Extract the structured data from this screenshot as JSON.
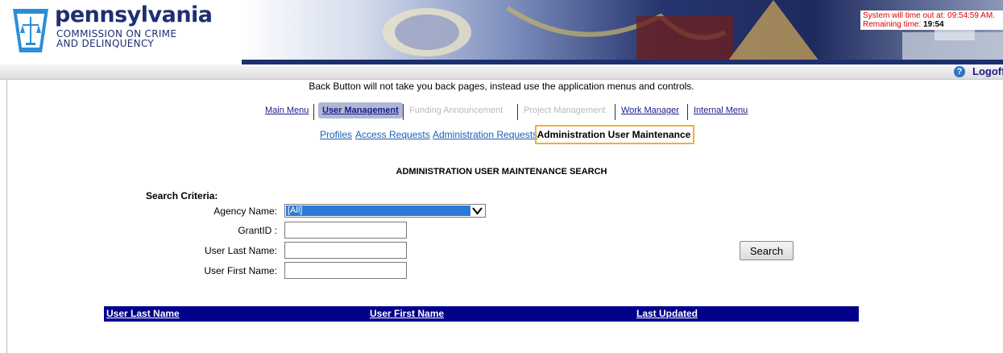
{
  "header": {
    "logo_title": "pennsylvania",
    "logo_sub_line1": "COMMISSION ON CRIME",
    "logo_sub_line2": "AND DELINQUENCY",
    "timeout_text": "System will time out at: 09:54:59 AM.",
    "remaining_label": "Remaining time: ",
    "remaining_value": "19:54"
  },
  "toolbar": {
    "help_icon": "help-icon",
    "logoff_label": "Logoff"
  },
  "notice": "Back Button will not take you back pages, instead use the application menus and controls.",
  "menu": {
    "main_menu": "Main Menu",
    "user_management": "User Management",
    "funding_announcement": "Funding Announcement",
    "project_management": "Project Management",
    "work_manager": "Work Manager",
    "internal_menu": "Internal Menu"
  },
  "submenu": {
    "profiles": "Profiles",
    "access_requests": "Access Requests",
    "administration_requests": "Administration Requests",
    "administration_user_maintenance": "Administration User Maintenance"
  },
  "search": {
    "title": "ADMINISTRATION USER MAINTENANCE SEARCH",
    "criteria_label": "Search Criteria:",
    "agency_label": "Agency Name:",
    "agency_value": "[All]",
    "grantid_label": "GrantID :",
    "last_name_label": "User Last Name:",
    "first_name_label": "User First Name:",
    "grantid_value": "",
    "last_name_value": "",
    "first_name_value": "",
    "search_button": "Search"
  },
  "results": {
    "columns": [
      "User Last Name",
      "User First Name",
      "Last Updated"
    ]
  },
  "colors": {
    "header_bar": "#00008b",
    "highlight_border": "#f0b03c",
    "active_tab": "#aeb8d2",
    "link": "#1a1a8c",
    "timeout_red": "#e00000"
  }
}
